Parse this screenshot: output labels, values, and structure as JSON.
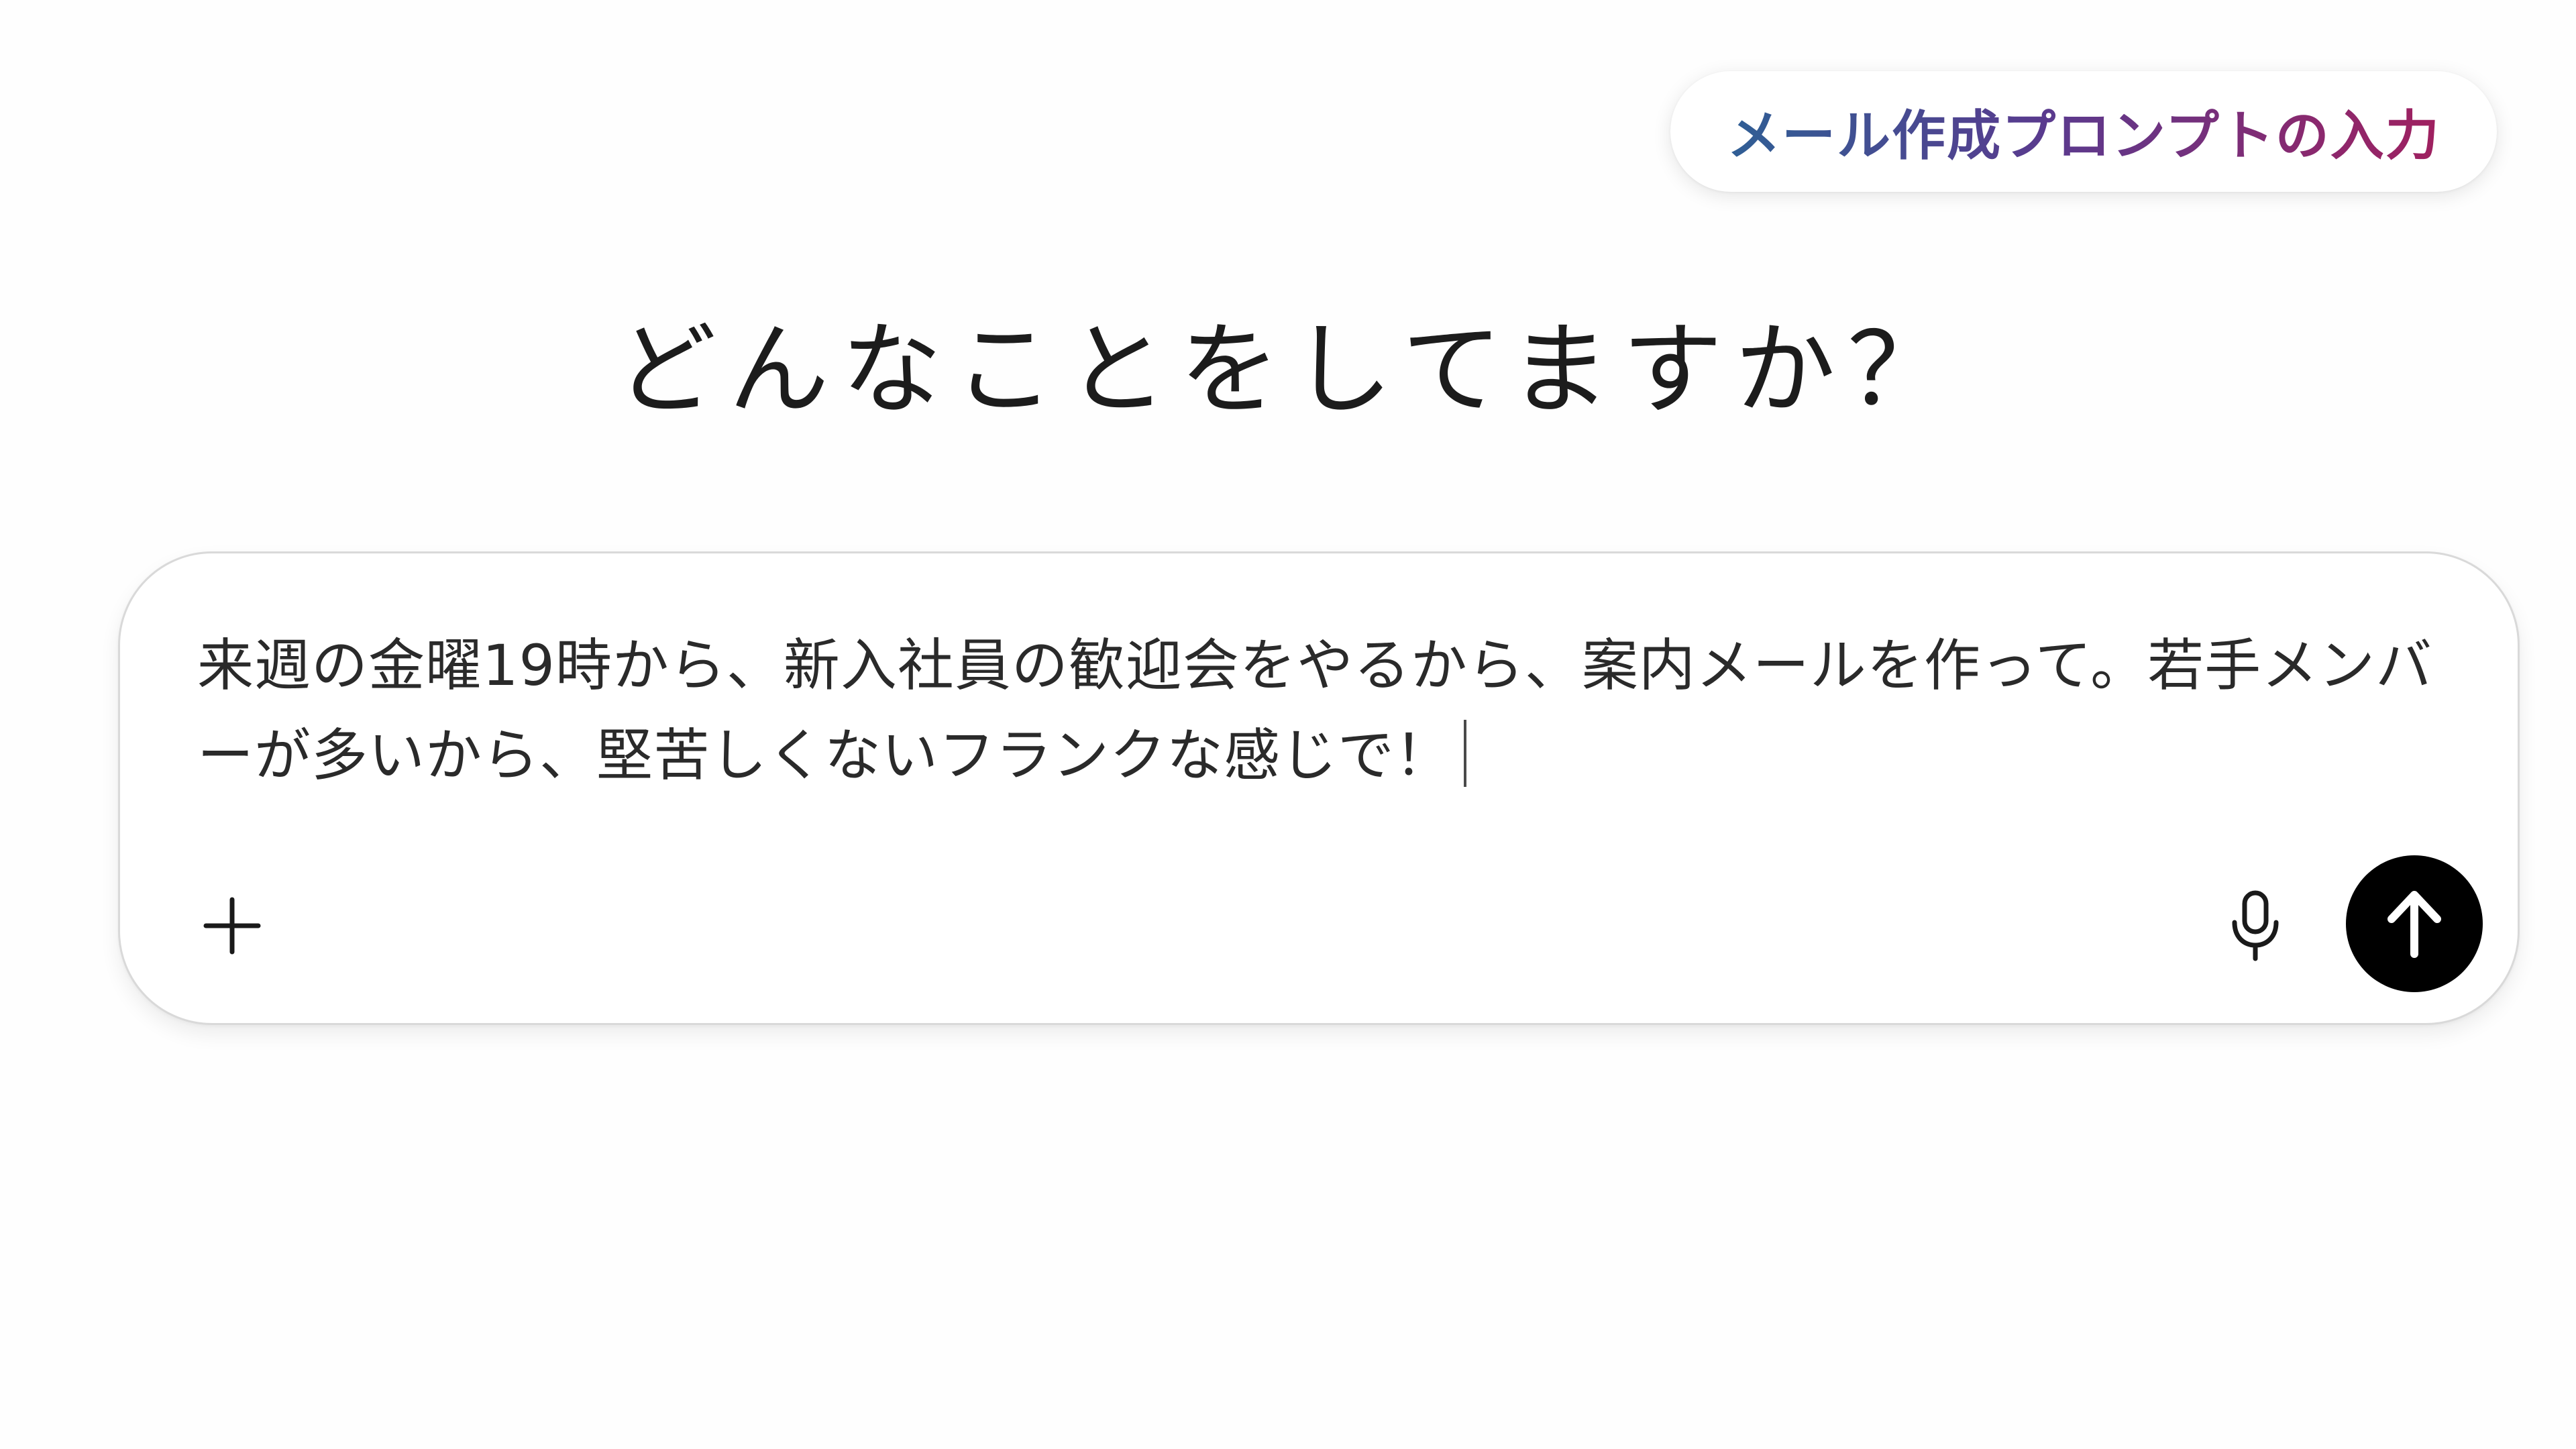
{
  "caption": {
    "text": "メール作成プロンプトの入力"
  },
  "main": {
    "headline": "どんなことをしてますか？"
  },
  "composer": {
    "value": "来週の金曜19時から、新入社員の歓迎会をやるから、案内メールを作って。若手メンバーが多いから、堅苦しくないフランクな感じで！",
    "icons": {
      "add": "plus-icon",
      "voice": "microphone-icon",
      "send": "arrow-up-icon"
    },
    "colors": {
      "send_button": "#000000",
      "border": "#d9d9d9"
    }
  }
}
